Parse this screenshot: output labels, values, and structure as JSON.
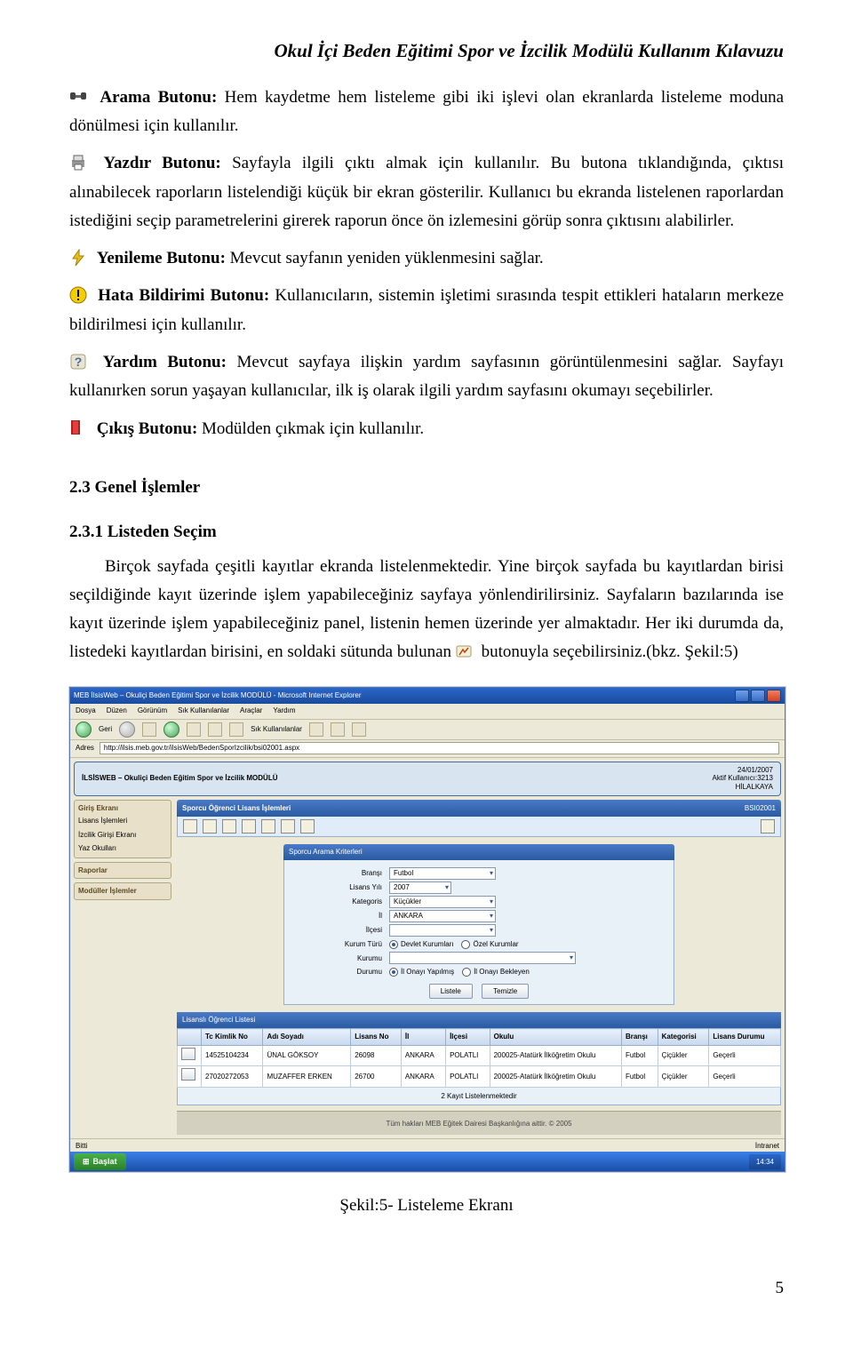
{
  "doc": {
    "header_title": "Okul İçi Beden Eğitimi Spor ve İzcilik Modülü Kullanım Kılavuzu",
    "arama_label": "Arama Butonu:",
    "arama_text_1": " Hem kaydetme hem listeleme gibi iki işlevi olan ekranlarda listeleme moduna dönülmesi için kullanılır.",
    "yazdir_label": "Yazdır Butonu:",
    "yazdir_text_1": " Sayfayla ilgili çıktı almak için kullanılır. Bu butona tıklandığında, çıktısı alınabilecek raporların listelendiği küçük bir ekran gösterilir. Kullanıcı bu ekranda listelenen raporlardan istediğini seçip parametrelerini girerek raporun önce ön izlemesini görüp sonra çıktısını alabilirler.",
    "yenileme_label": "Yenileme Butonu:",
    "yenileme_text": " Mevcut sayfanın yeniden yüklenmesini sağlar.",
    "hata_label": "Hata Bildirimi Butonu:",
    "hata_text": " Kullanıcıların, sistemin işletimi sırasında tespit ettikleri hataların merkeze bildirilmesi için kullanılır.",
    "yardim_label": "Yardım Butonu:",
    "yardim_text": " Mevcut sayfaya ilişkin yardım sayfasının görüntülenmesini sağlar. Sayfayı kullanırken sorun yaşayan kullanıcılar, ilk iş olarak ilgili yardım sayfasını okumayı seçebilirler.",
    "cikis_label": "Çıkış Butonu:",
    "cikis_text": " Modülden çıkmak için kullanılır.",
    "sect_2_3": "2.3 Genel İşlemler",
    "sub_2_3_1": "2.3.1 Listeden Seçim",
    "liste_text_a": "Birçok sayfada çeşitli kayıtlar ekranda listelenmektedir. Yine birçok sayfada bu kayıtlardan birisi seçildiğinde kayıt üzerinde işlem yapabileceğiniz sayfaya yönlendirilirsiniz. Sayfaların bazılarında ise kayıt üzerinde işlem yapabileceğiniz panel, listenin hemen üzerinde yer almaktadır. Her iki durumda da, listedeki kayıtlardan birisini, en soldaki sütunda bulunan ",
    "liste_text_b": " butonuyla seçebilirsiniz.(bkz. Şekil:5)",
    "caption": "Şekil:5- Listeleme Ekranı",
    "page_number": "5"
  },
  "screenshot": {
    "window_title": "MEB İlsisWeb – Okuliçi Beden Eğitimi Spor ve İzcilik MODÜLÜ - Microsoft Internet Explorer",
    "menubar": [
      "Dosya",
      "Düzen",
      "Görünüm",
      "Sık Kullanılanlar",
      "Araçlar",
      "Yardım"
    ],
    "toolbar": {
      "geri": "Geri",
      "fav": "Sık Kullanılanlar"
    },
    "address_label": "Adres",
    "address_url": "http://ilsis.meb.gov.tr/ilsisWeb/BedenSporIzcilik/bsi02001.aspx",
    "mod_header_left": "İLSİSWEB – Okuliçi Beden Eğitim Spor ve İzcilik MODÜLÜ",
    "mod_header_date": "24/01/2007",
    "mod_header_user": "Aktif Kullanıcı:3213",
    "mod_header_city": "HİLALKAYA",
    "sidebar": [
      {
        "title": "Giriş Ekranı",
        "items": [
          "Lisans İşlemleri",
          "İzcilik Girişi Ekranı",
          "Yaz Okulları"
        ]
      },
      {
        "title": "Raporlar",
        "items": []
      },
      {
        "title": "Modüller İşlemler",
        "items": []
      }
    ],
    "islem_title": "Sporcu Öğrenci Lisans İşlemleri",
    "islem_code": "BSI02001",
    "search_panel_title": "Sporcu Arama Kriterleri",
    "form": {
      "brans_label": "Branşı",
      "brans_value": "Futbol",
      "lisansyili_label": "Lisans Yılı",
      "lisansyili_value": "2007",
      "kategori_label": "Kategoris",
      "kategori_value": "Küçükler",
      "il_label": "İl",
      "il_value": "ANKARA",
      "ilce_label": "İlçesi",
      "ilce_value": "",
      "kurumturu_label": "Kurum Türü",
      "kurumturu_opt1": "Devlet Kurumları",
      "kurumturu_opt2": "Özel Kurumlar",
      "kurumu_label": "Kurumu",
      "kurumu_value": "",
      "durumu_label": "Durumu",
      "durumu_opt1": "İl Onayı Yapılmış",
      "durumu_opt2": "İl Onayı Bekleyen",
      "btn_listele": "Listele",
      "btn_temizle": "Temizle"
    },
    "list_panel_title": "Lisanslı Öğrenci Listesi",
    "table": {
      "headers": [
        "",
        "Tc Kimlik No",
        "Adı Soyadı",
        "Lisans No",
        "İl",
        "İlçesi",
        "Okulu",
        "Branşı",
        "Kategorisi",
        "Lisans Durumu"
      ],
      "rows": [
        [
          "",
          "14525104234",
          "ÜNAL GÖKSOY",
          "26098",
          "ANKARA",
          "POLATLI",
          "200025-Atatürk İlköğretim Okulu",
          "Futbol",
          "Çiçükler",
          "Geçerli"
        ],
        [
          "",
          "27020272053",
          "MUZAFFER ERKEN",
          "26700",
          "ANKARA",
          "POLATLI",
          "200025-Atatürk İlköğretim Okulu",
          "Futbol",
          "Çiçükler",
          "Geçerli"
        ]
      ],
      "footer": "2 Kayıt Listelenmektedir"
    },
    "footer_text": "Tüm hakları MEB Eğitek Dairesi Başkanlığına aittir. © 2005",
    "status_left": "Bitti",
    "status_right": "İntranet",
    "start_label": "Başlat",
    "clock": "14:34"
  }
}
